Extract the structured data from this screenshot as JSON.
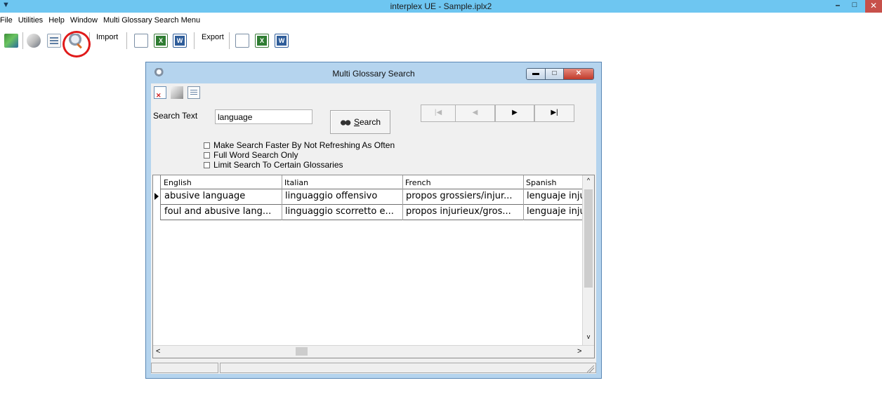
{
  "app": {
    "title": "interplex UE - Sample.iplx2",
    "sys_icon": "▼",
    "title_buttons": {
      "minimize": "–",
      "maximize": "□",
      "close": "✕"
    }
  },
  "menu": [
    "File",
    "Utilities",
    "Help",
    "Window",
    "Multi Glossary Search Menu"
  ],
  "toolbar": {
    "import_label": "Import",
    "export_label": "Export",
    "icons": [
      "exit-icon",
      "tools-icon",
      "document-icon",
      "search-glossary-icon",
      "blank-doc-icon",
      "excel-icon",
      "word-icon"
    ]
  },
  "dialog": {
    "title": "Multi Glossary Search",
    "controls": {
      "minimize": "▬",
      "maximize": "□",
      "close": "✕"
    },
    "search_label": "Search Text",
    "search_value": "language",
    "search_button": "Search",
    "nav": {
      "first": "|◀",
      "prev": "◀",
      "next": "▶",
      "last": "▶|"
    },
    "options": [
      "Make Search Faster By Not Refreshing As Often",
      "Full Word Search Only",
      "Limit Search To Certain Glossaries"
    ],
    "grid": {
      "columns": [
        "English",
        "Italian",
        "French",
        "Spanish"
      ],
      "rows": [
        [
          "abusive language",
          "linguaggio offensivo",
          "propos grossiers/injur...",
          "lenguaje inju"
        ],
        [
          "foul and abusive lang...",
          "linguaggio scorretto e...",
          "propos injurieux/gros...",
          "lenguaje inju"
        ]
      ]
    },
    "scroll": {
      "up": "^",
      "down": "v",
      "left": "<",
      "right": ">"
    }
  }
}
